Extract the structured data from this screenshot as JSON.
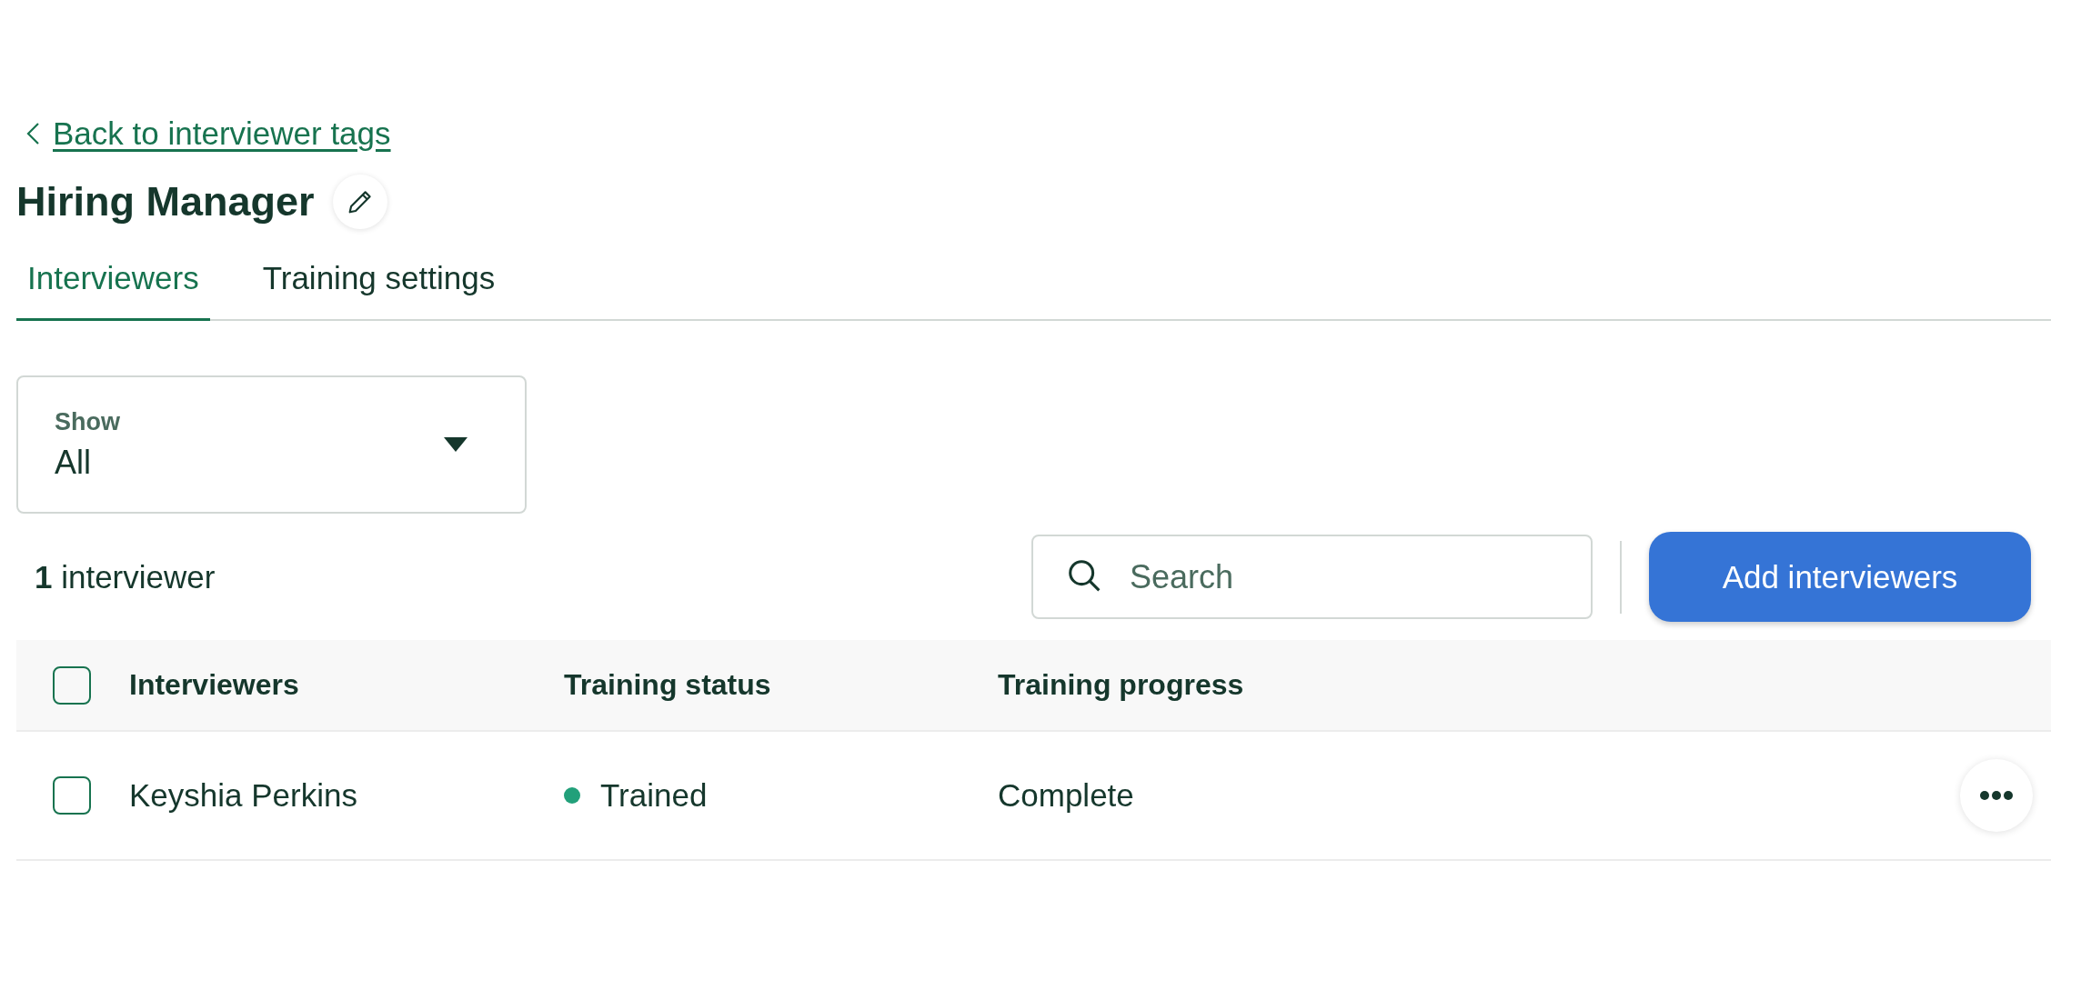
{
  "back_link": {
    "label": "Back to interviewer tags"
  },
  "title": "Hiring Manager",
  "tabs": [
    {
      "label": "Interviewers",
      "selected": true
    },
    {
      "label": "Training settings",
      "selected": false
    }
  ],
  "filter": {
    "label": "Show",
    "value": "All"
  },
  "count": "**1** interviewer",
  "search": {
    "placeholder": "Search"
  },
  "add_button": "Add interviewers",
  "table": {
    "select_all_checked": false,
    "columns": [
      "Interviewers",
      "Training status",
      "Training progress"
    ],
    "rows": [
      {
        "checked": false,
        "name": "Keyshia Perkins",
        "status": "Trained",
        "color": "#22a07a",
        "progress": "Complete"
      }
    ]
  }
}
